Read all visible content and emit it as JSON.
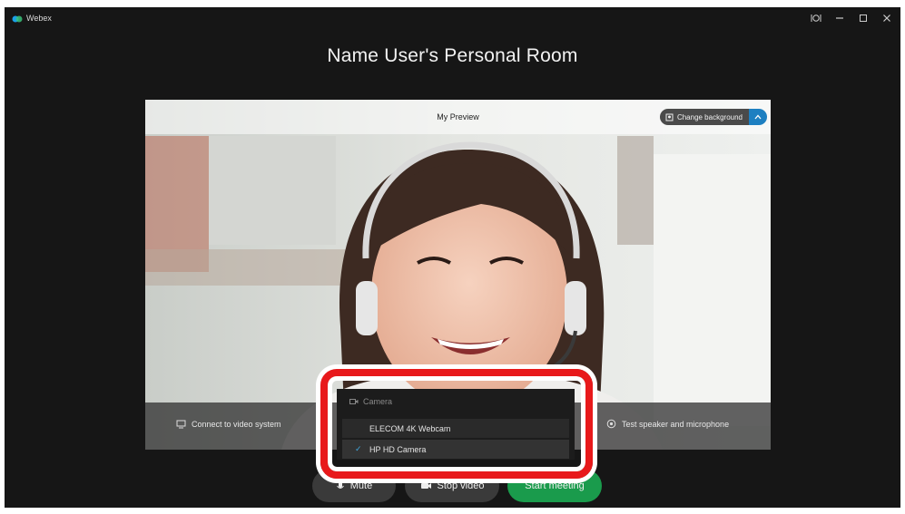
{
  "app": {
    "name": "Webex",
    "window_controls": [
      "help-icon",
      "minimize-icon",
      "maximize-icon",
      "close-icon"
    ]
  },
  "room": {
    "title": "Name User's Personal Room"
  },
  "preview": {
    "label": "My Preview",
    "change_background_label": "Change background",
    "connect_label": "Connect to video system",
    "test_audio_label": "Test speaker and microphone"
  },
  "camera_menu": {
    "header": "Camera",
    "options": [
      {
        "label": "ELECOM 4K Webcam",
        "selected": false
      },
      {
        "label": "HP HD Camera",
        "selected": true
      }
    ]
  },
  "controls": {
    "mute_label": "Mute",
    "video_label": "Stop video",
    "start_label": "Start meeting"
  },
  "colors": {
    "window_bg": "#161616",
    "highlight": "#e8191b",
    "start_button": "#1a9b4c",
    "accent": "#1d7fc1"
  }
}
